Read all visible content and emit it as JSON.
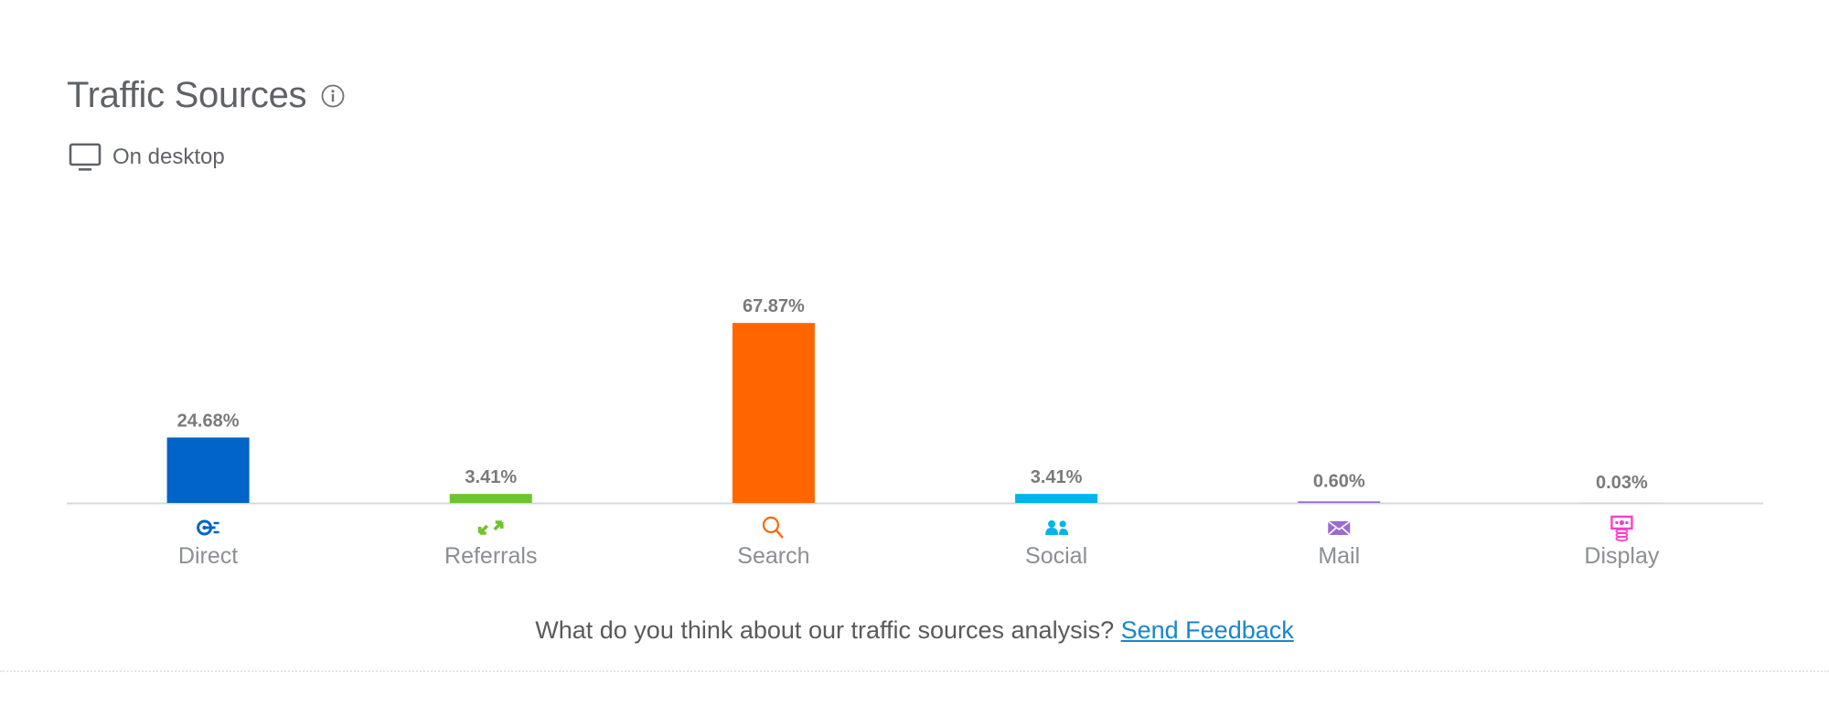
{
  "header": {
    "title": "Traffic Sources",
    "info_icon": "info-icon",
    "device_icon": "desktop-monitor-icon",
    "device_label": "On desktop"
  },
  "chart_data": {
    "type": "bar",
    "title": "Traffic Sources",
    "xlabel": "",
    "ylabel": "",
    "ylim": [
      0,
      100
    ],
    "grid": false,
    "legend": "none",
    "categories": [
      "Direct",
      "Referrals",
      "Search",
      "Social",
      "Mail",
      "Display"
    ],
    "values": [
      24.68,
      3.41,
      67.87,
      3.41,
      0.6,
      0.03
    ],
    "value_labels": [
      "24.68%",
      "3.41%",
      "67.87%",
      "3.41%",
      "0.60%",
      "0.03%"
    ],
    "colors": [
      "#0064c8",
      "#6dc52d",
      "#ff6600",
      "#00b4ee",
      "#9b6ad6",
      "#ff3ec9"
    ],
    "icons": [
      "direct-target-icon",
      "referrals-arrows-icon",
      "search-magnifier-icon",
      "social-people-icon",
      "mail-envelope-icon",
      "display-ad-icon"
    ]
  },
  "footer": {
    "question": "What do you think about our traffic sources analysis?",
    "link_label": "Send Feedback"
  }
}
